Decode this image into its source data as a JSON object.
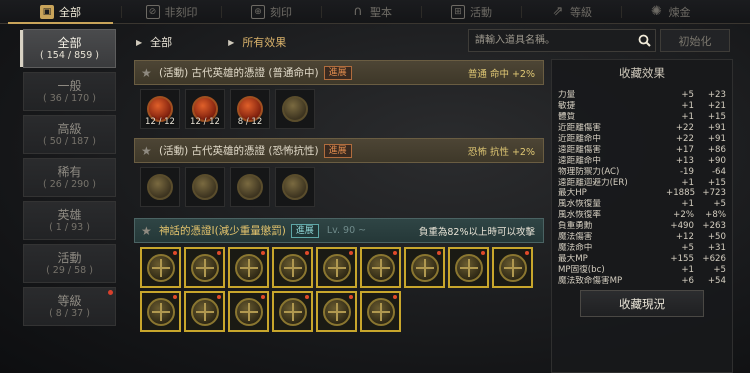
{
  "tabs": [
    {
      "label": "全部",
      "icon": "book-icon",
      "active": true
    },
    {
      "label": "非刻印",
      "icon": "stamp-off-icon",
      "active": false
    },
    {
      "label": "刻印",
      "icon": "stamp-icon",
      "active": false
    },
    {
      "label": "聖本",
      "icon": "horseshoe-icon",
      "active": false
    },
    {
      "label": "活動",
      "icon": "gift-icon",
      "active": false
    },
    {
      "label": "等級",
      "icon": "level-icon",
      "active": false
    },
    {
      "label": "煉金",
      "icon": "alchemy-icon",
      "active": false
    }
  ],
  "sidebar": {
    "items": [
      {
        "name": "全部",
        "count": "( 154 / 859 )",
        "active": true
      },
      {
        "name": "一般",
        "count": "( 36 / 170 )"
      },
      {
        "name": "高級",
        "count": "( 50 / 187 )"
      },
      {
        "name": "稀有",
        "count": "( 26 / 290 )"
      },
      {
        "name": "英雄",
        "count": "( 1 / 93 )"
      },
      {
        "name": "活動",
        "count": "( 29 / 58 )"
      },
      {
        "name": "等級",
        "count": "( 8 / 37 )",
        "alert": true
      }
    ]
  },
  "breadcrumb": {
    "first": "全部",
    "second": "所有效果"
  },
  "search": {
    "placeholder": "請輸入道具名稱。",
    "value": ""
  },
  "reset_label": "初始化",
  "groups": [
    {
      "title": "(活動) 古代英雄的憑證 (普通命中)",
      "badge": "進展",
      "effect": "普通 命中 +2%",
      "items": [
        {
          "qty": "12 / 12",
          "style": "red"
        },
        {
          "qty": "12 / 12",
          "style": "red"
        },
        {
          "qty": "8 / 12",
          "style": "red"
        },
        {
          "qty": "",
          "style": "plain"
        }
      ]
    },
    {
      "title": "(活動) 古代英雄的憑證 (恐怖抗性)",
      "badge": "進展",
      "effect": "恐怖 抗性 +2%",
      "items": [
        {
          "qty": "",
          "style": "plain"
        },
        {
          "qty": "",
          "style": "plain"
        },
        {
          "qty": "",
          "style": "plain"
        },
        {
          "qty": "",
          "style": "plain"
        }
      ]
    },
    {
      "title": "神話的憑證I(減少重量懲罰)",
      "badge": "進展",
      "level": "Lv. 90 ~",
      "effect": "負重為82%以上時可以攻擊"
    }
  ],
  "panel": {
    "title": "收藏效果",
    "button": "收藏現況",
    "stats": [
      {
        "name": "力量",
        "a": "+5",
        "b": "+23"
      },
      {
        "name": "敏捷",
        "a": "+1",
        "b": "+21"
      },
      {
        "name": "體質",
        "a": "+1",
        "b": "+15"
      },
      {
        "name": "近距離傷害",
        "a": "+22",
        "b": "+91"
      },
      {
        "name": "近距離命中",
        "a": "+22",
        "b": "+91"
      },
      {
        "name": "遠距離傷害",
        "a": "+17",
        "b": "+86"
      },
      {
        "name": "遠距離命中",
        "a": "+13",
        "b": "+90"
      },
      {
        "name": "物理防禦力(AC)",
        "a": "-19",
        "b": "-64"
      },
      {
        "name": "遠距離迴避力(ER)",
        "a": "+1",
        "b": "+15"
      },
      {
        "name": "最大HP",
        "a": "+1885",
        "b": "+723"
      },
      {
        "name": "風水恢復量",
        "a": "+1",
        "b": "+5"
      },
      {
        "name": "風水恢復率",
        "a": "+2%",
        "b": "+8%"
      },
      {
        "name": "負重勇勳",
        "a": "+490",
        "b": "+263"
      },
      {
        "name": "魔法傷害",
        "a": "+12",
        "b": "+50"
      },
      {
        "name": "魔法命中",
        "a": "+5",
        "b": "+31"
      },
      {
        "name": "最大MP",
        "a": "+155",
        "b": "+626"
      },
      {
        "name": "MP固復(bc)",
        "a": "+1",
        "b": "+5"
      },
      {
        "name": "魔法致命傷害MP",
        "a": "+6",
        "b": "+54"
      }
    ]
  },
  "colors": {
    "accent_gold": "#c9a45a",
    "effect_text": "#e0c874",
    "alert_red": "#d8402c"
  }
}
